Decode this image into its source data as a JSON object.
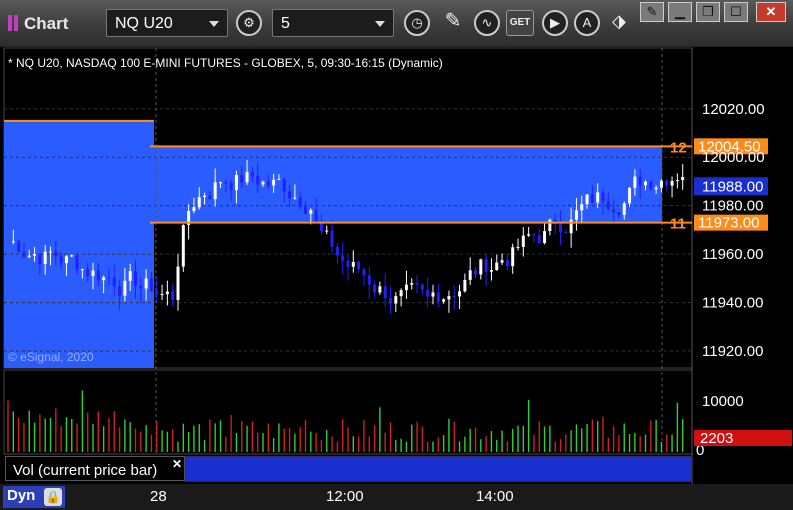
{
  "app": {
    "title": "Chart"
  },
  "toolbar": {
    "symbol": "NQ U20",
    "interval": "5",
    "get_label": "GET"
  },
  "chart_header": "* NQ U20, NASDAQ 100 E-MINI FUTURES - GLOBEX, 5, 09:30-16:15 (Dynamic)",
  "watermark": "© eSignal, 2020",
  "colors": {
    "up_candle": "#ffffff",
    "down_candle": "#2020ff",
    "highlight_zone": "#2a5cff",
    "level_line": "#ff8c1a",
    "volume_up": "#2fd02f",
    "volume_down": "#d02020"
  },
  "chart_data": {
    "type": "candlestick",
    "price_axis": {
      "ticks": [
        12020,
        12000,
        11980,
        11960,
        11940,
        11920
      ],
      "tick_labels": [
        "12020.00",
        "12000.00",
        "11980.00",
        "11960.00",
        "11940.00",
        "11920.00"
      ],
      "ylim": [
        11913,
        12036
      ]
    },
    "levels": [
      {
        "price": 12004.5,
        "label": "12004.50",
        "left_label": "12"
      },
      {
        "price": 11973.0,
        "label": "11973.00",
        "left_label": "11"
      }
    ],
    "last_price": {
      "price": 11988.0,
      "label": "11988.00"
    },
    "time_axis": {
      "labels": [
        "28",
        "12:00",
        "14:00"
      ]
    },
    "volume": {
      "title": "Vol (current price bar)",
      "axis_labels": [
        "10000",
        "0"
      ],
      "last_value": "2203"
    }
  },
  "bottom": {
    "mode": "Dyn"
  }
}
